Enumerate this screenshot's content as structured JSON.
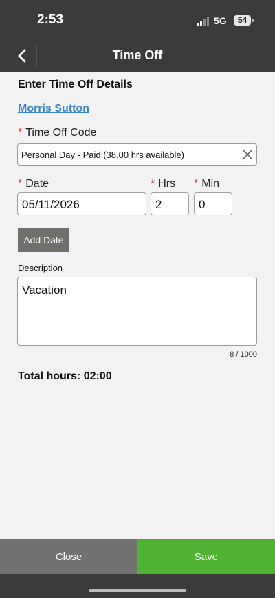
{
  "status_bar": {
    "time": "2:53",
    "network": "5G",
    "battery": "54"
  },
  "nav": {
    "title": "Time Off"
  },
  "form": {
    "section_title": "Enter Time Off Details",
    "employee_name": "Morris Sutton",
    "required_marker": "*",
    "time_off_code": {
      "label": "Time Off Code",
      "value": "Personal Day - Paid (38.00 hrs available)"
    },
    "date": {
      "label": "Date",
      "value": "05/11/2026"
    },
    "hours": {
      "label": "Hrs",
      "value": "2"
    },
    "minutes": {
      "label": "Min",
      "value": "0"
    },
    "add_date_label": "Add Date",
    "description": {
      "label": "Description",
      "value": "Vacation",
      "char_count": "8 / 1000"
    },
    "total_hours": "Total hours: 02:00"
  },
  "footer": {
    "close_label": "Close",
    "save_label": "Save"
  },
  "colors": {
    "header_bg": "#3b3b3b",
    "link": "#3a86c8",
    "save_bg": "#4fb233",
    "close_bg": "#727270",
    "required": "#d01818"
  }
}
